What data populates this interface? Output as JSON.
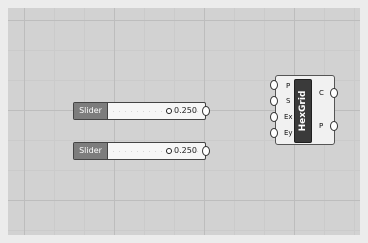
{
  "canvas": {
    "grid": true
  },
  "sliders": [
    {
      "label": "Slider",
      "value": "0.250"
    },
    {
      "label": "Slider",
      "value": "0.250"
    }
  ],
  "component": {
    "title": "HexGrid",
    "inputs": [
      "P",
      "S",
      "Ex",
      "Ey"
    ],
    "outputs": [
      "C",
      "P"
    ]
  }
}
